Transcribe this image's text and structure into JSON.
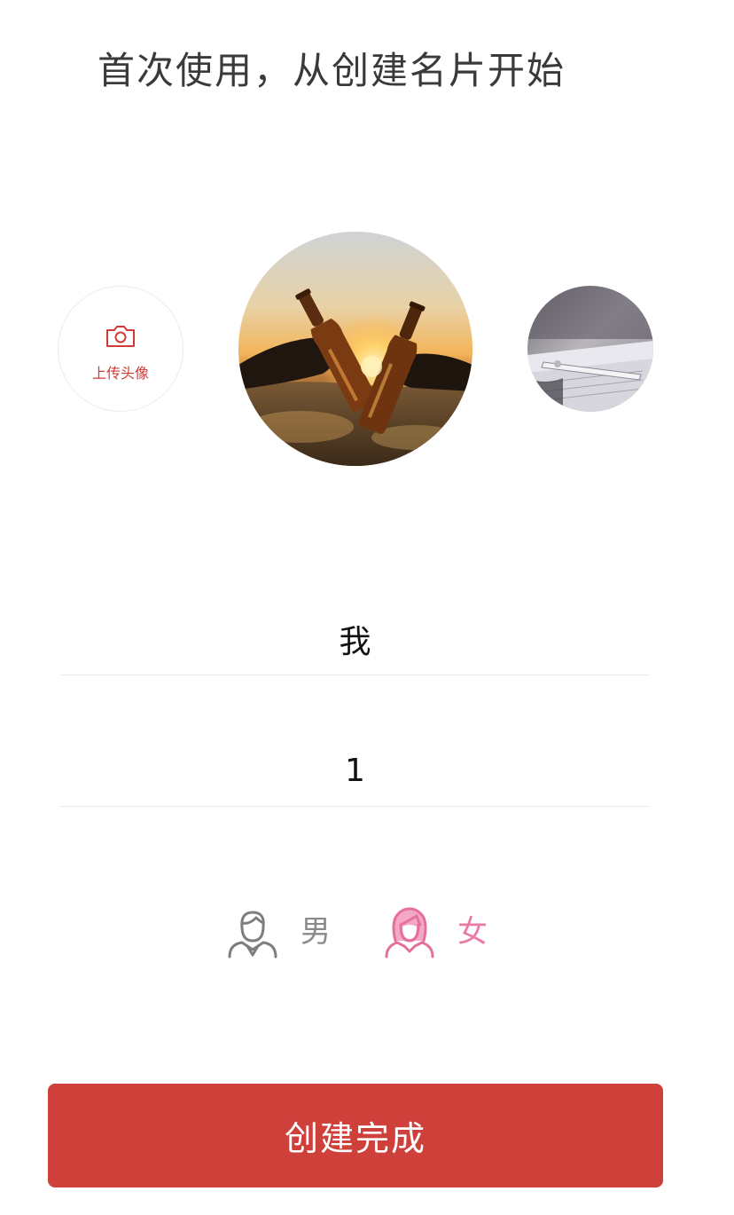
{
  "header": {
    "title": "首次使用，从创建名片开始"
  },
  "avatars": {
    "upload_label": "上传头像",
    "upload_icon": "camera-icon",
    "selected_photo": "beer-toast-sunset-photo",
    "next_photo": "pen-on-notebook-photo"
  },
  "form": {
    "name_value": "我",
    "number_value": "1"
  },
  "gender": {
    "male_label": "男",
    "female_label": "女",
    "male_icon": "male-user-icon",
    "female_icon": "female-user-icon",
    "selected": "female"
  },
  "submit": {
    "label": "创建完成"
  },
  "colors": {
    "accent": "#cf403a",
    "upload_text": "#cf3b36",
    "female_selected": "#ea7aa6",
    "male_unselected": "#8a8a8a"
  }
}
